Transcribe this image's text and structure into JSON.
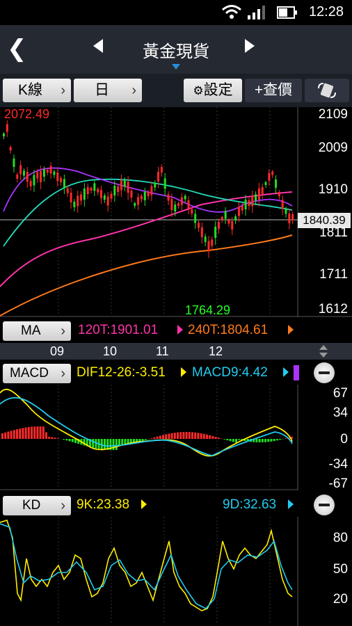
{
  "status_bar": {
    "time": "12:28"
  },
  "header": {
    "title": "黃金現貨"
  },
  "toolbar": {
    "chart_type": "K線",
    "period": "日",
    "settings": "設定",
    "add_quote": "+查價"
  },
  "main_chart": {
    "high_label": "2072.49",
    "low_label": "1764.29",
    "current_price": "1840.39",
    "y_ticks": [
      "2109",
      "2009",
      "1910",
      "1811",
      "1711",
      "1612"
    ]
  },
  "ma_row": {
    "button": "MA",
    "ma120": "120T:1901.01",
    "ma240": "240T:1804.61"
  },
  "months": [
    "09",
    "10",
    "11",
    "12"
  ],
  "macd": {
    "button": "MACD",
    "dif": "DIF12-26:-3.51",
    "macd9": "MACD9:4.42",
    "y_ticks": [
      "67",
      "34",
      "0",
      "-34",
      "-67"
    ]
  },
  "kd": {
    "button": "KD",
    "k": "9K:23.38",
    "d": "9D:32.63",
    "y_ticks": [
      "80",
      "50",
      "20"
    ]
  },
  "colors": {
    "up": "#ff2a2a",
    "down": "#22dd22",
    "ma120": "#ff33aa",
    "ma240": "#ff7a1a",
    "dif": "#ffee00",
    "macd9": "#22ccee",
    "header_bg": "#252932",
    "accent": "#2a8fd8"
  }
}
